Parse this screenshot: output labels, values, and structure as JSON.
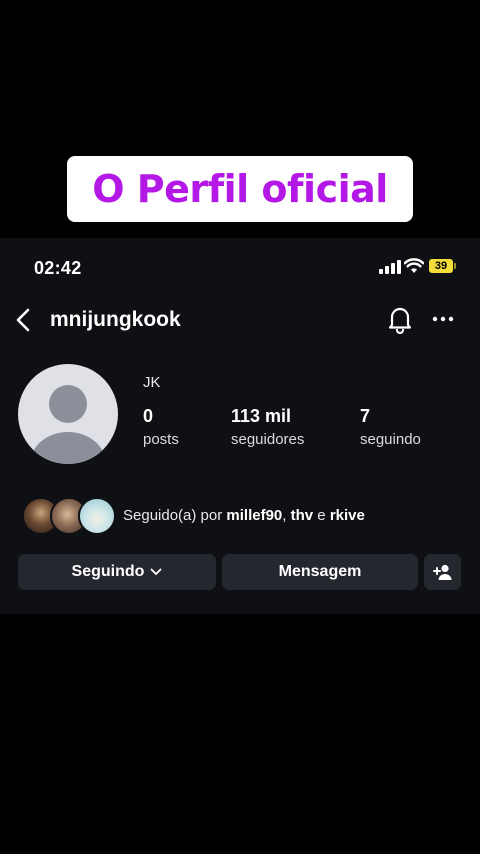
{
  "caption": {
    "text": "O Perfil oficial"
  },
  "status_bar": {
    "time": "02:42",
    "battery": "39"
  },
  "header": {
    "username": "mnijungkook",
    "back_icon": "chevron-left-icon",
    "notification_icon": "bell-icon",
    "more_icon": "more-horizontal-icon"
  },
  "profile": {
    "display_name": "JK",
    "stats": [
      {
        "value": "0",
        "label": "posts"
      },
      {
        "value": "113 mil",
        "label": "seguidores"
      },
      {
        "value": "7",
        "label": "seguindo"
      }
    ]
  },
  "followed_by": {
    "prefix": "Seguido(a) por ",
    "user1": "millef90",
    "separator": ", ",
    "user2": "thv",
    "connector": " e ",
    "user3": "rkive"
  },
  "actions": {
    "following_label": "Seguindo",
    "message_label": "Mensagem",
    "add_friend_icon": "add-person-icon"
  },
  "colors": {
    "caption_text": "#b318e6",
    "screen_bg": "#0f1014",
    "button_bg": "#25272e",
    "battery": "#f2dd3a"
  }
}
